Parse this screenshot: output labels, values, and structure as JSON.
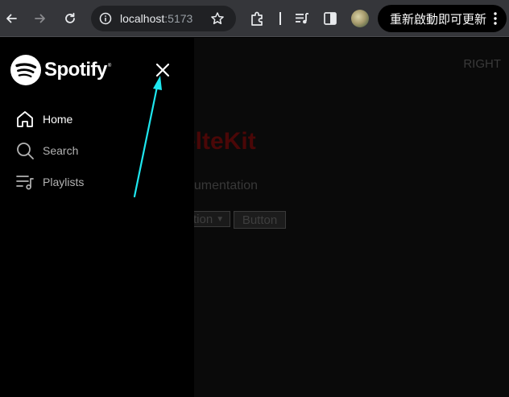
{
  "browser": {
    "url_host": "localhost",
    "url_port": ":5173",
    "update_label": "重新啟動即可更新"
  },
  "page": {
    "right_text": "RIGHT",
    "title_text": "elteKit",
    "doc_text": "ocumentation",
    "select_text": "tion",
    "button_label": "Button"
  },
  "sidebar": {
    "logo_text": "Spotify",
    "logo_mark": "®",
    "nav": [
      {
        "label": "Home",
        "icon": "home-icon"
      },
      {
        "label": "Search",
        "icon": "search-icon"
      },
      {
        "label": "Playlists",
        "icon": "playlist-icon"
      }
    ]
  },
  "colors": {
    "annotation_arrow": "#1ee6ee",
    "spotify_text": "#ffffff",
    "nav_inactive": "#b3b3b3",
    "page_title_red": "#4a0707"
  }
}
